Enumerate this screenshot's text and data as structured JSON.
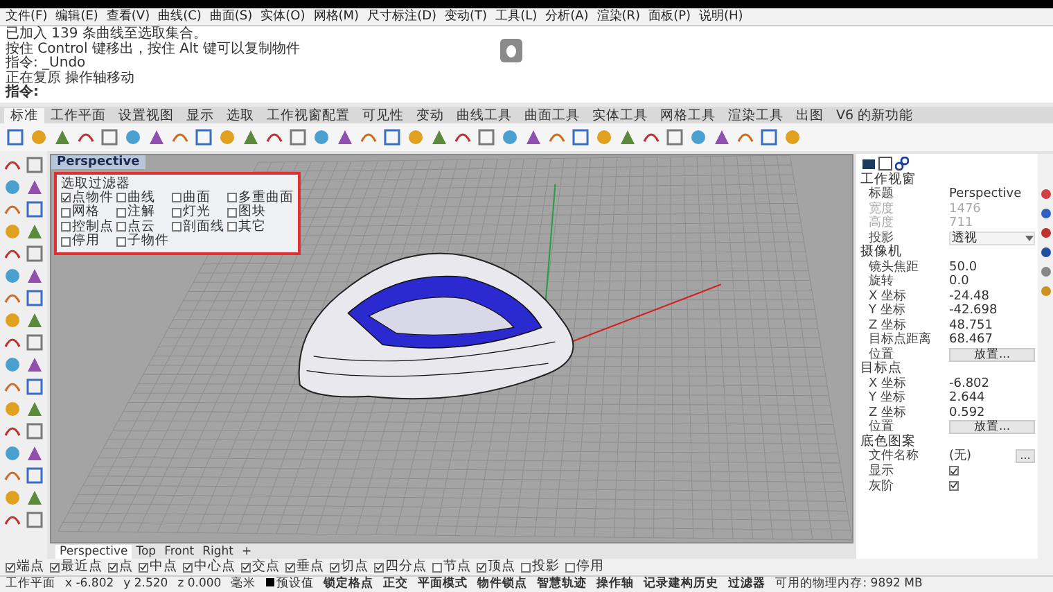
{
  "menu": [
    "文件(F)",
    "编辑(E)",
    "查看(V)",
    "曲线(C)",
    "曲面(S)",
    "实体(O)",
    "网格(M)",
    "尺寸标注(D)",
    "变动(T)",
    "工具(L)",
    "分析(A)",
    "渲染(R)",
    "面板(P)",
    "说明(H)"
  ],
  "command_history": [
    "已加入 139 条曲线至选取集合。",
    "按住 Control 键移出，按住 Alt 键可以复制物件",
    "指令: _Undo",
    "正在复原 操作轴移动"
  ],
  "command_prompt": "指令:",
  "toolbar_tabs": [
    {
      "label": "标准",
      "selected": true
    },
    {
      "label": "工作平面",
      "selected": false
    },
    {
      "label": "设置视图",
      "selected": false
    },
    {
      "label": "显示",
      "selected": false
    },
    {
      "label": "选取",
      "selected": false
    },
    {
      "label": "工作视窗配置",
      "selected": false
    },
    {
      "label": "可见性",
      "selected": false
    },
    {
      "label": "变动",
      "selected": false
    },
    {
      "label": "曲线工具",
      "selected": false
    },
    {
      "label": "曲面工具",
      "selected": false
    },
    {
      "label": "实体工具",
      "selected": false
    },
    {
      "label": "网格工具",
      "selected": false
    },
    {
      "label": "渲染工具",
      "selected": false
    },
    {
      "label": "出图",
      "selected": false
    },
    {
      "label": "V6 的新功能",
      "selected": false
    }
  ],
  "viewport": {
    "title": "Perspective",
    "tabs": [
      {
        "label": "Perspective",
        "selected": true
      },
      {
        "label": "Top",
        "selected": false
      },
      {
        "label": "Front",
        "selected": false
      },
      {
        "label": "Right",
        "selected": false
      }
    ],
    "add_tab": "+"
  },
  "selection_filter": {
    "title": "选取过滤器",
    "items": [
      {
        "label": "点物件",
        "checked": true
      },
      {
        "label": "曲线",
        "checked": false
      },
      {
        "label": "曲面",
        "checked": false
      },
      {
        "label": "多重曲面",
        "checked": false
      },
      {
        "label": "网格",
        "checked": false
      },
      {
        "label": "注解",
        "checked": false
      },
      {
        "label": "灯光",
        "checked": false
      },
      {
        "label": "图块",
        "checked": false
      },
      {
        "label": "控制点",
        "checked": false
      },
      {
        "label": "点云",
        "checked": false
      },
      {
        "label": "剖面线",
        "checked": false
      },
      {
        "label": "其它",
        "checked": false
      },
      {
        "label": "停用",
        "checked": false
      },
      {
        "label": "子物件",
        "checked": false
      }
    ]
  },
  "properties": [
    {
      "title": "工作视窗",
      "rows": [
        {
          "kind": "text",
          "label": "标题",
          "value": "Perspective"
        },
        {
          "kind": "readonly",
          "label": "宽度",
          "value": "1476"
        },
        {
          "kind": "readonly",
          "label": "高度",
          "value": "711"
        },
        {
          "kind": "dropdown",
          "label": "投影",
          "value": "透视"
        }
      ]
    },
    {
      "title": "摄像机",
      "rows": [
        {
          "kind": "text",
          "label": "镜头焦距",
          "value": "50.0"
        },
        {
          "kind": "text",
          "label": "旋转",
          "value": "0.0"
        },
        {
          "kind": "text",
          "label": "X 坐标",
          "value": "-24.48"
        },
        {
          "kind": "text",
          "label": "Y 坐标",
          "value": "-42.698"
        },
        {
          "kind": "text",
          "label": "Z 坐标",
          "value": "48.751"
        },
        {
          "kind": "text",
          "label": "目标点距离",
          "value": "68.467"
        },
        {
          "kind": "button",
          "label": "位置",
          "value": "放置..."
        }
      ]
    },
    {
      "title": "目标点",
      "rows": [
        {
          "kind": "text",
          "label": "X 坐标",
          "value": "-6.802"
        },
        {
          "kind": "text",
          "label": "Y 坐标",
          "value": "2.644"
        },
        {
          "kind": "text",
          "label": "Z 坐标",
          "value": "0.592"
        },
        {
          "kind": "button",
          "label": "位置",
          "value": "放置..."
        }
      ]
    },
    {
      "title": "底色图案",
      "rows": [
        {
          "kind": "browse",
          "label": "文件名称",
          "value": "(无)",
          "button": "..."
        },
        {
          "kind": "checkbox",
          "label": "显示",
          "checked": true
        },
        {
          "kind": "checkbox",
          "label": "灰阶",
          "checked": true
        }
      ]
    }
  ],
  "osnap": [
    {
      "label": "端点",
      "checked": true
    },
    {
      "label": "最近点",
      "checked": true
    },
    {
      "label": "点",
      "checked": true
    },
    {
      "label": "中点",
      "checked": true
    },
    {
      "label": "中心点",
      "checked": true
    },
    {
      "label": "交点",
      "checked": true
    },
    {
      "label": "垂点",
      "checked": true
    },
    {
      "label": "切点",
      "checked": true
    },
    {
      "label": "四分点",
      "checked": true
    },
    {
      "label": "节点",
      "checked": false
    },
    {
      "label": "顶点",
      "checked": true
    },
    {
      "label": "投影",
      "checked": false
    },
    {
      "label": "停用",
      "checked": false
    }
  ],
  "status_bar": [
    {
      "kind": "text",
      "text": "工作平面"
    },
    {
      "kind": "text",
      "text": "x -6.802"
    },
    {
      "kind": "text",
      "text": "y 2.520"
    },
    {
      "kind": "text",
      "text": "z 0.000"
    },
    {
      "kind": "text",
      "text": "毫米"
    },
    {
      "kind": "layer",
      "text": "预设值"
    },
    {
      "kind": "toggle",
      "text": "锁定格点"
    },
    {
      "kind": "toggle",
      "text": "正交"
    },
    {
      "kind": "toggle",
      "text": "平面模式"
    },
    {
      "kind": "toggle",
      "text": "物件锁点"
    },
    {
      "kind": "toggle",
      "text": "智慧轨迹"
    },
    {
      "kind": "toggle",
      "text": "操作轴"
    },
    {
      "kind": "toggle",
      "text": "记录建构历史"
    },
    {
      "kind": "toggle",
      "text": "过滤器"
    },
    {
      "kind": "text",
      "text": "可用的物理内存: 9892 MB"
    }
  ]
}
